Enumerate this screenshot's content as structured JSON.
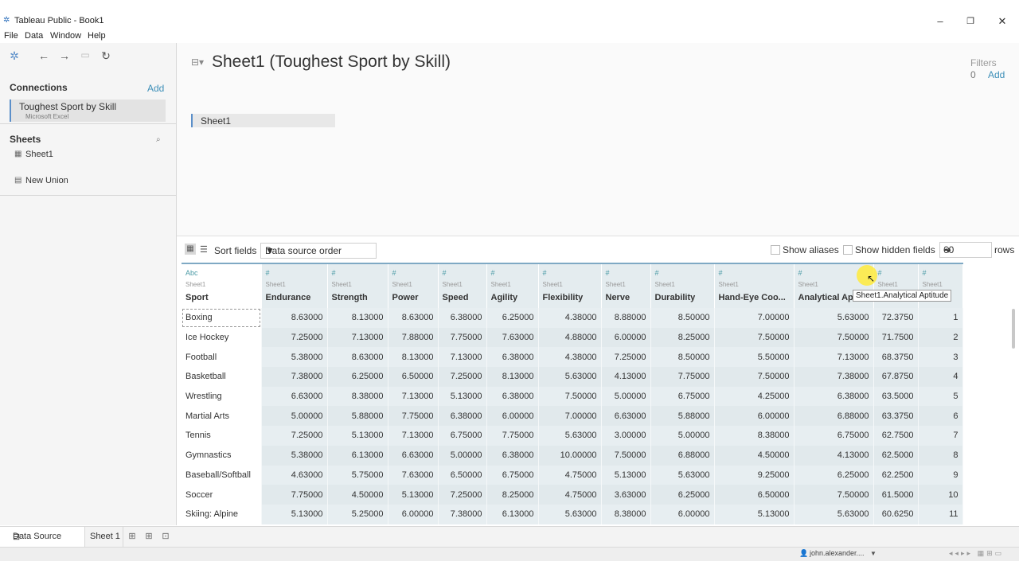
{
  "window": {
    "title": "Tableau Public - Book1",
    "menu": [
      "File",
      "Data",
      "Window",
      "Help"
    ],
    "minimize_icon": "minimize-icon",
    "restore_icon": "restore-icon",
    "close_icon": "close-icon"
  },
  "sidebar": {
    "connections_title": "Connections",
    "connections_add": "Add",
    "connection": {
      "name": "Toughest Sport by Skill",
      "type": "Microsoft Excel"
    },
    "sheets_title": "Sheets",
    "sheets": [
      "Sheet1"
    ],
    "new_union": "New Union"
  },
  "canvas": {
    "title": "Sheet1 (Toughest Sport by Skill)",
    "filters_label": "Filters",
    "filters_count": "0",
    "filters_add": "Add",
    "sheet_pill": "Sheet1"
  },
  "grid_toolbar": {
    "sort_label": "Sort fields",
    "sort_value": "Data source order",
    "show_aliases": "Show aliases",
    "show_hidden_fields": "Show hidden fields",
    "rows_value": "60",
    "rows_label": "rows"
  },
  "columns": [
    {
      "type": "Abc",
      "source": "Sheet1",
      "name": "Sport"
    },
    {
      "type": "#",
      "source": "Sheet1",
      "name": "Endurance"
    },
    {
      "type": "#",
      "source": "Sheet1",
      "name": "Strength"
    },
    {
      "type": "#",
      "source": "Sheet1",
      "name": "Power"
    },
    {
      "type": "#",
      "source": "Sheet1",
      "name": "Speed"
    },
    {
      "type": "#",
      "source": "Sheet1",
      "name": "Agility"
    },
    {
      "type": "#",
      "source": "Sheet1",
      "name": "Flexibility"
    },
    {
      "type": "#",
      "source": "Sheet1",
      "name": "Nerve"
    },
    {
      "type": "#",
      "source": "Sheet1",
      "name": "Durability"
    },
    {
      "type": "#",
      "source": "Sheet1",
      "name": "Hand-Eye Coo..."
    },
    {
      "type": "#",
      "source": "Sheet1",
      "name": "Analytical Apti..."
    },
    {
      "type": "#",
      "source": "Sheet1",
      "name": "Total"
    },
    {
      "type": "#",
      "source": "Sheet1",
      "name": "Rank"
    }
  ],
  "rows": [
    [
      "Boxing",
      "8.63000",
      "8.13000",
      "8.63000",
      "6.38000",
      "6.25000",
      "4.38000",
      "8.88000",
      "8.50000",
      "7.00000",
      "5.63000",
      "72.3750",
      "1"
    ],
    [
      "Ice Hockey",
      "7.25000",
      "7.13000",
      "7.88000",
      "7.75000",
      "7.63000",
      "4.88000",
      "6.00000",
      "8.25000",
      "7.50000",
      "7.50000",
      "71.7500",
      "2"
    ],
    [
      "Football",
      "5.38000",
      "8.63000",
      "8.13000",
      "7.13000",
      "6.38000",
      "4.38000",
      "7.25000",
      "8.50000",
      "5.50000",
      "7.13000",
      "68.3750",
      "3"
    ],
    [
      "Basketball",
      "7.38000",
      "6.25000",
      "6.50000",
      "7.25000",
      "8.13000",
      "5.63000",
      "4.13000",
      "7.75000",
      "7.50000",
      "7.38000",
      "67.8750",
      "4"
    ],
    [
      "Wrestling",
      "6.63000",
      "8.38000",
      "7.13000",
      "5.13000",
      "6.38000",
      "7.50000",
      "5.00000",
      "6.75000",
      "4.25000",
      "6.38000",
      "63.5000",
      "5"
    ],
    [
      "Martial Arts",
      "5.00000",
      "5.88000",
      "7.75000",
      "6.38000",
      "6.00000",
      "7.00000",
      "6.63000",
      "5.88000",
      "6.00000",
      "6.88000",
      "63.3750",
      "6"
    ],
    [
      "Tennis",
      "7.25000",
      "5.13000",
      "7.13000",
      "6.75000",
      "7.75000",
      "5.63000",
      "3.00000",
      "5.00000",
      "8.38000",
      "6.75000",
      "62.7500",
      "7"
    ],
    [
      "Gymnastics",
      "5.38000",
      "6.13000",
      "6.63000",
      "5.00000",
      "6.38000",
      "10.00000",
      "7.50000",
      "6.88000",
      "4.50000",
      "4.13000",
      "62.5000",
      "8"
    ],
    [
      "Baseball/Softball",
      "4.63000",
      "5.75000",
      "7.63000",
      "6.50000",
      "6.75000",
      "4.75000",
      "5.13000",
      "5.63000",
      "9.25000",
      "6.25000",
      "62.2500",
      "9"
    ],
    [
      "Soccer",
      "7.75000",
      "4.50000",
      "5.13000",
      "7.25000",
      "8.25000",
      "4.75000",
      "3.63000",
      "6.25000",
      "6.50000",
      "7.50000",
      "61.5000",
      "10"
    ],
    [
      "Skiing: Alpine",
      "5.13000",
      "5.25000",
      "6.00000",
      "7.38000",
      "6.13000",
      "5.63000",
      "8.38000",
      "6.00000",
      "5.13000",
      "5.63000",
      "60.6250",
      "11"
    ]
  ],
  "tooltip": "Sheet1.Analytical Aptitude",
  "bottom_tabs": {
    "data_source": "Data Source",
    "sheet1": "Sheet 1"
  },
  "status": {
    "user": "john.alexander...."
  }
}
